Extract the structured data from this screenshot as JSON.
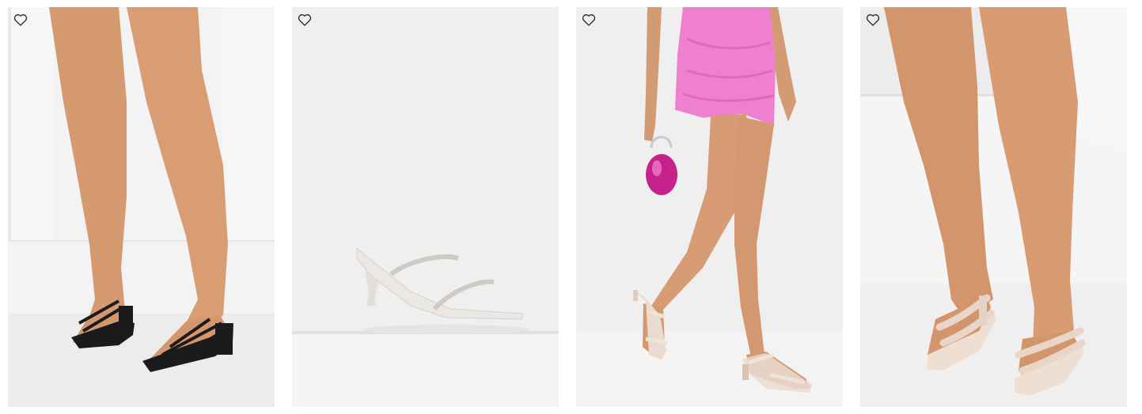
{
  "products": [
    {
      "image_alt": "",
      "wishlist_icon": "heart-outline-icon"
    },
    {
      "image_alt": "",
      "wishlist_icon": "heart-outline-icon"
    },
    {
      "image_alt": "",
      "wishlist_icon": "heart-outline-icon"
    },
    {
      "image_alt": "",
      "wishlist_icon": "heart-outline-icon"
    }
  ],
  "colors": {
    "background": "#ffffff",
    "photo_backdrop": "#f1f1f1",
    "skin": "#d79a72",
    "black_heel": "#1a1a1a",
    "white_heel": "#ebe8e3",
    "pink_dress": "#ee7fcf",
    "magenta_bag": "#c8238e",
    "cream_heel": "#eedbcf",
    "icon_stroke": "#222222"
  }
}
